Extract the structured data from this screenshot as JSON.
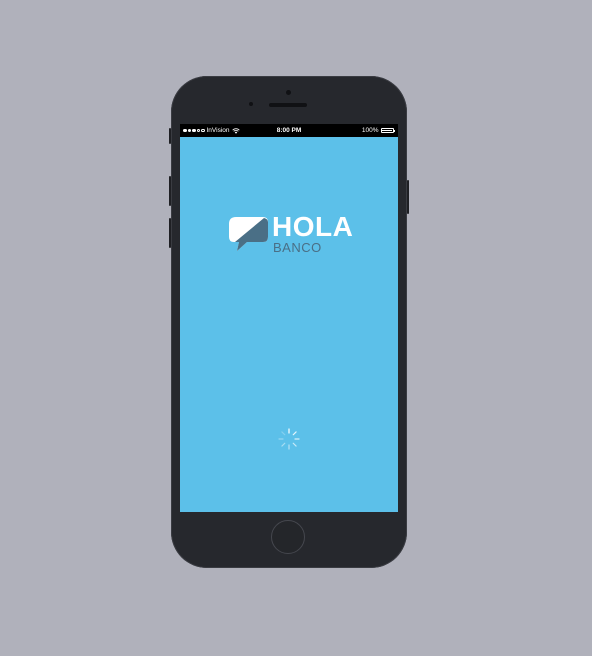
{
  "status_bar": {
    "carrier": "InVision",
    "time": "8:00 PM",
    "battery_percent": "100%",
    "signal_bars_filled": 3,
    "signal_bars_total": 5
  },
  "splash": {
    "title": "HOLA",
    "subtitle": "BANCO",
    "loading_indicator": "spinner"
  },
  "colors": {
    "background": "#b0b1bb",
    "screen": "#5cc0e9",
    "logo_primary": "#ffffff",
    "logo_secondary": "#4a6f86"
  }
}
